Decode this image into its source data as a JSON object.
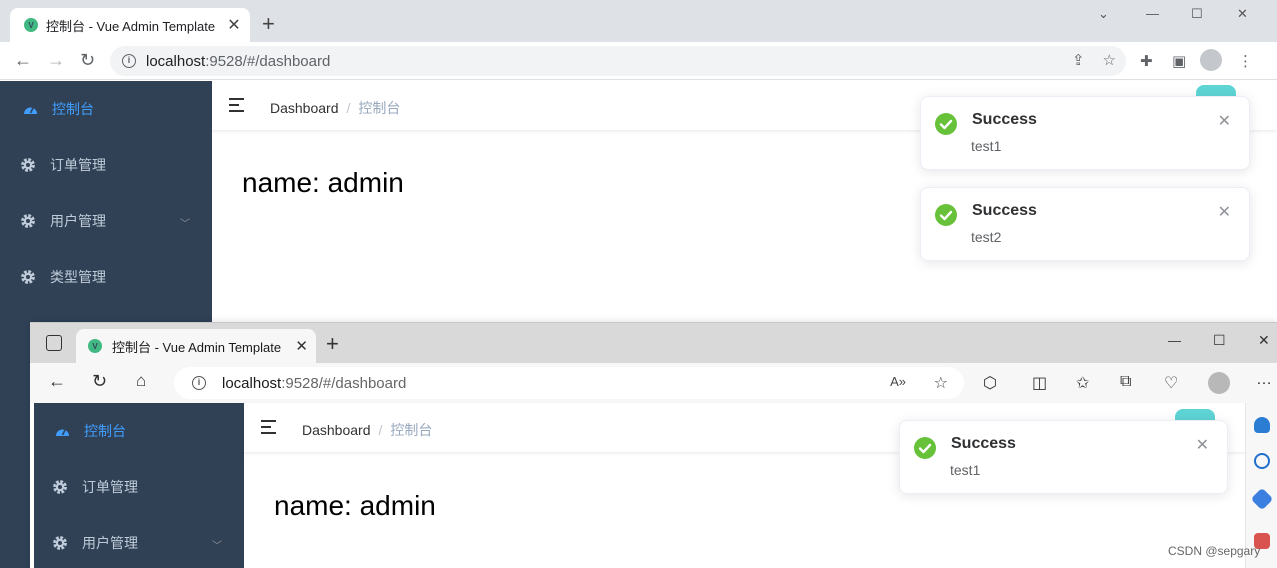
{
  "chrome": {
    "tab_title": "控制台 - Vue Admin Template",
    "new_tab": "+",
    "url_host": "localhost",
    "url_path": ":9528/#/dashboard"
  },
  "edge": {
    "tab_title": "控制台 - Vue Admin Template",
    "new_tab": "+",
    "url_host": "localhost",
    "url_path": ":9528/#/dashboard"
  },
  "app_top": {
    "menu": [
      {
        "label": "控制台",
        "icon": "dashboard-icon",
        "active": true
      },
      {
        "label": "订单管理",
        "icon": "gear-icon"
      },
      {
        "label": "用户管理",
        "icon": "gear-icon",
        "has_children": true
      },
      {
        "label": "类型管理",
        "icon": "gear-icon"
      }
    ],
    "breadcrumb": {
      "home": "Dashboard",
      "separator": "/",
      "current": "控制台"
    },
    "name_text": "name: admin",
    "notifications": [
      {
        "title": "Success",
        "message": "test1"
      },
      {
        "title": "Success",
        "message": "test2"
      }
    ]
  },
  "app_bottom": {
    "menu": [
      {
        "label": "控制台",
        "icon": "dashboard-icon",
        "active": true
      },
      {
        "label": "订单管理",
        "icon": "gear-icon"
      },
      {
        "label": "用户管理",
        "icon": "gear-icon",
        "has_children": true
      }
    ],
    "breadcrumb": {
      "home": "Dashboard",
      "separator": "/",
      "current": "控制台"
    },
    "name_text": "name: admin",
    "notifications": [
      {
        "title": "Success",
        "message": "test1"
      }
    ]
  },
  "watermark": "CSDN @sepgary",
  "colors": {
    "sidebar_bg": "#304156",
    "menu_text": "#bfcbd9",
    "menu_active": "#409eff",
    "success": "#67c23a",
    "avatar_btn": "#5ed4d5"
  }
}
